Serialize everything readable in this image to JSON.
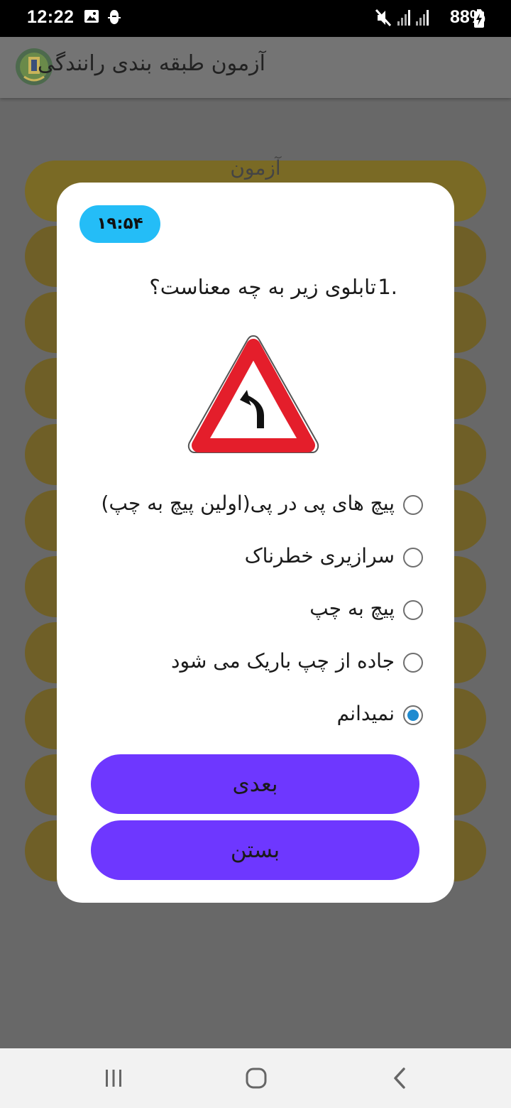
{
  "status_bar": {
    "time": "12:22",
    "battery_percent": "88%",
    "icons": [
      "image-icon",
      "android-debug-icon",
      "mute-icon",
      "signal-icon",
      "signal-icon",
      "battery-charging-icon"
    ]
  },
  "app_bar": {
    "title": "آزمون طبقه بندی رانندگی",
    "logo_icon": "police-emblem-icon"
  },
  "background": {
    "first_item_text": "آزمون"
  },
  "dialog": {
    "timer": "۱۹:۵۴",
    "question_number": "1.",
    "question_text": "تابلوی زیر به چه معناست؟",
    "sign_icon": "curve-left-warning-sign-icon",
    "options": [
      {
        "label": "پیچ های پی در پی(اولین پیچ به چپ)",
        "checked": false
      },
      {
        "label": "سرازیری خطرناک",
        "checked": false
      },
      {
        "label": "پیچ به چپ",
        "checked": false
      },
      {
        "label": "جاده از چپ باریک می شود",
        "checked": false
      },
      {
        "label": "نمیدانم",
        "checked": true
      }
    ],
    "next_button": "بعدی",
    "close_button": "بستن"
  },
  "nav_bar": {
    "icons": [
      "recent-apps-icon",
      "home-icon",
      "back-icon"
    ]
  },
  "colors": {
    "timer_bg": "#24bdf7",
    "button_bg": "#6e37ff",
    "radio_checked": "#1f8bd0",
    "sign_border": "#e41e2b"
  }
}
